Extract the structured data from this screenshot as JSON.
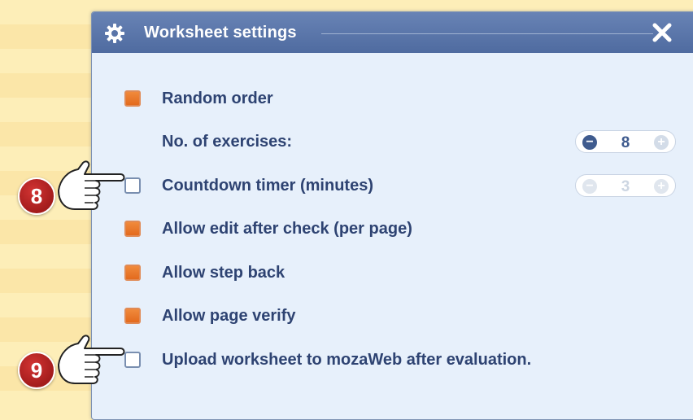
{
  "dialog": {
    "title": "Worksheet settings",
    "gear_icon": "gear-icon",
    "close_icon": "close-icon"
  },
  "options": [
    {
      "id": "random-order",
      "label": "Random order",
      "checked": true
    },
    {
      "id": "countdown-timer",
      "label": "Countdown timer (minutes)",
      "checked": false
    },
    {
      "id": "allow-edit",
      "label": "Allow edit after check (per page)",
      "checked": true
    },
    {
      "id": "allow-step-back",
      "label": "Allow step back",
      "checked": true
    },
    {
      "id": "allow-page-verify",
      "label": "Allow page verify",
      "checked": true
    },
    {
      "id": "upload-worksheet",
      "label": "Upload worksheet to mozaWeb after evaluation.",
      "checked": false
    }
  ],
  "exercises": {
    "label": "No. of exercises:",
    "value": "8",
    "enabled": true
  },
  "timer": {
    "value": "3",
    "enabled": false
  },
  "callouts": [
    {
      "number": "8",
      "icon": "pointing-hand-icon"
    },
    {
      "number": "9",
      "icon": "pointing-hand-icon"
    }
  ],
  "colors": {
    "titlebar": "#5a75a9",
    "checkbox_on": "#e8732a",
    "label_text": "#2e4372",
    "badge": "#b22222",
    "background": "#fdeeb8"
  }
}
